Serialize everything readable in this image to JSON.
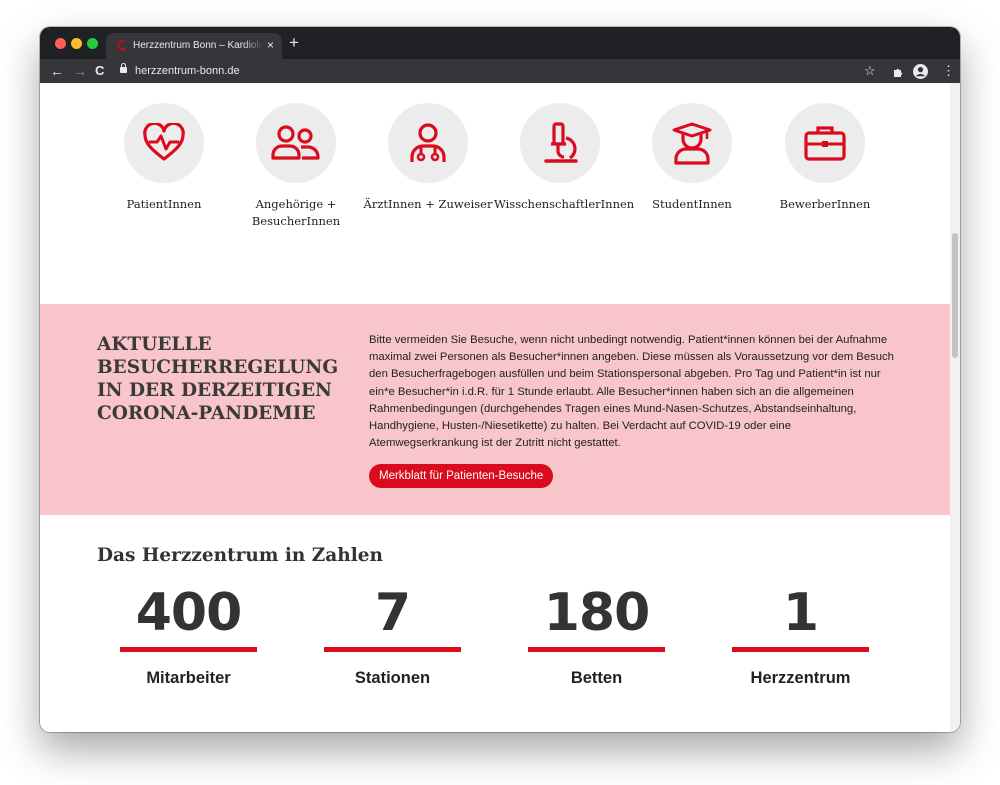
{
  "browser": {
    "tab_title": "Herzzentrum Bonn – Kardiolog",
    "tab_close": "×",
    "new_tab": "+",
    "url": "herzzentrum-bonn.de",
    "back": "←",
    "forward": "→",
    "reload": "C",
    "bookmark": "☆",
    "menu": "⋮"
  },
  "categories": [
    {
      "label": "PatientInnen",
      "icon": "heart-pulse-icon"
    },
    {
      "label": "Angehörige + BesucherInnen",
      "icon": "people-icon"
    },
    {
      "label": "ÄrztInnen + Zuweiser",
      "icon": "doctor-icon"
    },
    {
      "label": "WisschenschaftlerInnen",
      "icon": "microscope-icon"
    },
    {
      "label": "StudentInnen",
      "icon": "graduate-icon"
    },
    {
      "label": "BewerberInnen",
      "icon": "briefcase-icon"
    }
  ],
  "notice": {
    "heading": "AKTUELLE BESUCHERREGELUNG IN DER DERZEITIGEN CORONA-PANDEMIE",
    "body": "Bitte vermeiden Sie Besuche, wenn nicht unbedingt notwendig. Patient*innen können bei der Aufnahme maximal zwei Personen als Besucher*innen angeben. Diese müssen als Voraussetzung vor dem Besuch den Besucherfragebogen ausfüllen und beim Stationspersonal abgeben. Pro Tag und Patient*in ist nur ein*e Besucher*in i.d.R. für 1 Stunde erlaubt. Alle Besucher*innen haben sich an die allgemeinen Rahmenbedingungen (durchgehendes Tragen eines Mund-Nasen-Schutzes, Abstandseinhaltung, Handhygiene, Husten-/Niesetikette) zu halten. Bei Verdacht auf COVID-19 oder eine Atemwegserkrankung ist der Zutritt nicht gestattet.",
    "button": "Merkblatt für Patienten-Besuche"
  },
  "stats": {
    "title": "Das Herzzentrum in Zahlen",
    "items": [
      {
        "value": "400",
        "label": "Mitarbeiter"
      },
      {
        "value": "7",
        "label": "Stationen"
      },
      {
        "value": "180",
        "label": "Betten"
      },
      {
        "value": "1",
        "label": "Herzzentrum"
      }
    ]
  },
  "colors": {
    "accent": "#d90b1c",
    "notice_bg": "#f7c5ca",
    "icon_circle": "#ececec"
  }
}
